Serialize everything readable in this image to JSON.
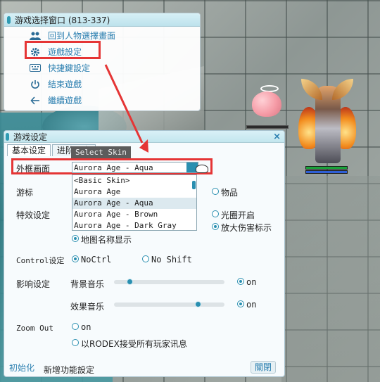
{
  "esc_menu": {
    "title": "游戏选择窗口 (813-337)",
    "items": [
      {
        "label": "回到人物選擇畫面",
        "icon": "people-icon"
      },
      {
        "label": "遊戲設定",
        "icon": "gear-icon"
      },
      {
        "label": "快捷鍵設定",
        "icon": "keyboard-icon"
      },
      {
        "label": "結束遊戲",
        "icon": "power-icon"
      },
      {
        "label": "繼續遊戲",
        "icon": "arrow-left-icon"
      }
    ]
  },
  "settings": {
    "title": "游戏设定",
    "close_glyph": "×",
    "tabs": [
      "基本设定",
      "进阶设定"
    ],
    "tooltip": "Select Skin",
    "skin": {
      "label": "外框画面",
      "value": "Aurora Age - Aqua",
      "options": [
        "<Basic Skin>",
        "Aurora Age",
        "Aurora Age - Aqua",
        "Aurora Age - Brown",
        "Aurora Age - Dark Gray"
      ]
    },
    "cursor_label": "游标",
    "items_label": "物品",
    "effects_label": "特效设定",
    "halo_label": "光圈开启",
    "damage_label": "放大伤害标示",
    "map_name_label": "地图名称显示",
    "control": {
      "label": "Control设定",
      "noctrl": "NoCtrl",
      "noshift": "No Shift"
    },
    "sound": {
      "label": "影响设定",
      "bgm_label": "背景音乐",
      "bgm_level": 0.12,
      "bgm_on": "on",
      "sfx_label": "效果音乐",
      "sfx_level": 0.78,
      "sfx_on": "on"
    },
    "zoom": {
      "label": "Zoom Out",
      "on": "on",
      "rodex": "以RODEX接受所有玩家讯息"
    },
    "footer": {
      "reset": "初始化",
      "new_features": "新增功能設定",
      "close": "關閉"
    }
  },
  "colors": {
    "accent": "#2a8fb0",
    "highlight": "#e53535",
    "title_bar": "#c3e6ee"
  }
}
